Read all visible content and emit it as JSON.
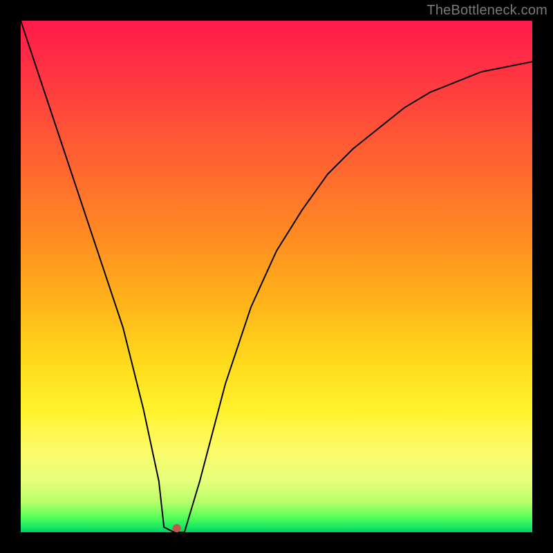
{
  "watermark": {
    "text": "TheBottleneck.com"
  },
  "chart_data": {
    "type": "line",
    "title": "",
    "xlabel": "",
    "ylabel": "",
    "xlim": [
      0,
      100
    ],
    "ylim": [
      0,
      100
    ],
    "grid": false,
    "series": [
      {
        "name": "curve",
        "x": [
          0,
          5,
          10,
          15,
          20,
          24,
          27,
          28,
          30,
          32,
          35,
          40,
          45,
          50,
          55,
          60,
          65,
          70,
          75,
          80,
          85,
          90,
          95,
          100
        ],
        "values": [
          100,
          85,
          70,
          55,
          40,
          24,
          10,
          1,
          0,
          0,
          10,
          29,
          44,
          55,
          63,
          70,
          75,
          79,
          83,
          86,
          88,
          90,
          91,
          92
        ]
      }
    ],
    "marker": {
      "x": 30.5,
      "y": 0.8,
      "color": "#c0574e",
      "radius": 6
    },
    "background_gradient": {
      "top": "#ff1a4b",
      "mid1": "#ff8b22",
      "mid2": "#ffd81a",
      "bottom": "#00d060"
    },
    "frame_color": "#000000",
    "curve_color": "#000000",
    "curve_width": 2
  }
}
